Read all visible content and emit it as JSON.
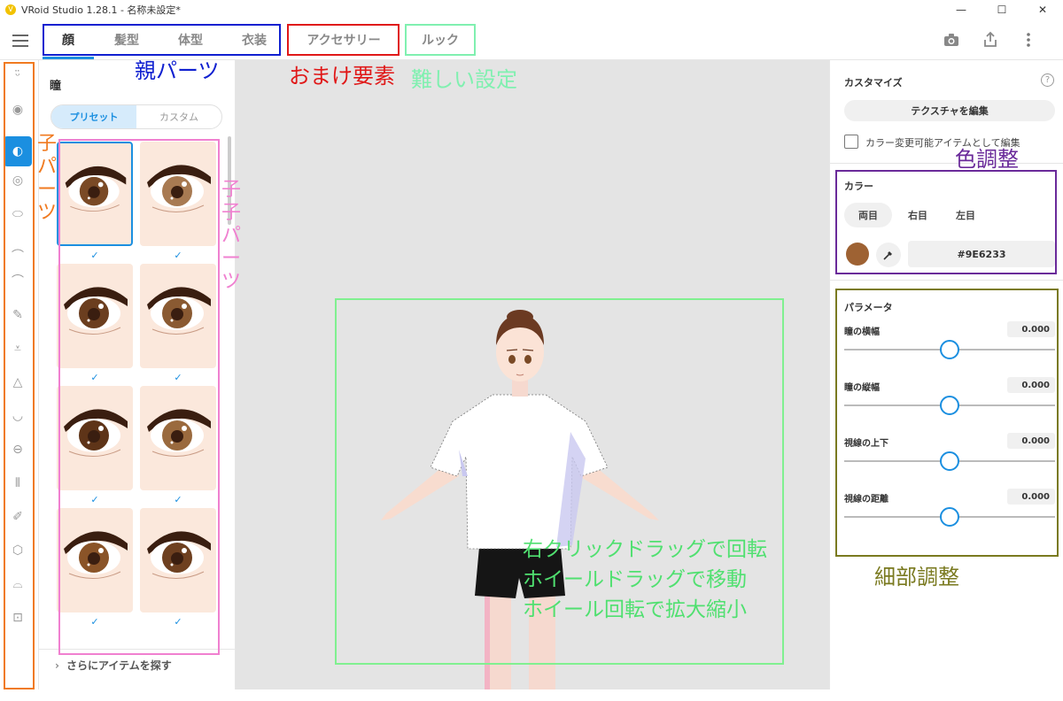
{
  "window": {
    "title": "VRoid Studio 1.28.1 - 名称未設定*",
    "minimize": "—",
    "maximize": "☐",
    "close": "✕"
  },
  "tabs": [
    {
      "label": "顔",
      "active": true
    },
    {
      "label": "髪型",
      "active": false
    },
    {
      "label": "体型",
      "active": false
    },
    {
      "label": "衣装",
      "active": false
    },
    {
      "label": "アクセサリー",
      "active": false
    },
    {
      "label": "ルック",
      "active": false
    }
  ],
  "toolbar_icons": [
    "camera-icon",
    "share-icon",
    "more-vertical-icon"
  ],
  "rail_icons": [
    "face-icon",
    "eyebrow-shape-icon",
    "iris-icon",
    "eye-white-icon",
    "eye-outline-icon",
    "eyebrow-icon",
    "eyelid-icon",
    "eyeliner-icon",
    "eyelash-icon",
    "nose-icon",
    "mouth-icon",
    "teeth-icon",
    "ears-icon",
    "skin-icon",
    "head-shape-icon",
    "ear-icon",
    "face-other-icon"
  ],
  "left_panel": {
    "title": "瞳",
    "segment": {
      "preset": "プリセット",
      "custom": "カスタム"
    },
    "check_mark": "✓",
    "more_items": "さらにアイテムを探す",
    "thumbnails": [
      {
        "name": "iris-preset-1",
        "iris": "#7a4a26",
        "selected": true
      },
      {
        "name": "iris-preset-2",
        "iris": "#a87a52",
        "selected": false
      },
      {
        "name": "iris-preset-3",
        "iris": "#6b3e1f",
        "selected": false
      },
      {
        "name": "iris-preset-4",
        "iris": "#8a5a32",
        "selected": false
      },
      {
        "name": "iris-preset-5",
        "iris": "#5e3418",
        "selected": false
      },
      {
        "name": "iris-preset-6",
        "iris": "#9a6a3e",
        "selected": false
      },
      {
        "name": "iris-preset-7",
        "iris": "#8a5428",
        "selected": false
      },
      {
        "name": "iris-preset-8",
        "iris": "#6e4020",
        "selected": false
      }
    ]
  },
  "right_panel": {
    "customize_title": "カスタマイズ",
    "help": "?",
    "edit_texture": "テクスチャを編集",
    "color_editable_label": "カラー変更可能アイテムとして編集",
    "color_title": "カラー",
    "eye_tabs": [
      "両目",
      "右目",
      "左目"
    ],
    "color_hex": "#9E6233",
    "color_value": "#9e6233",
    "params_title": "パラメータ",
    "params": [
      {
        "label": "瞳の横幅",
        "value": "0.000",
        "level": 0.5
      },
      {
        "label": "瞳の縦幅",
        "value": "0.000",
        "level": 0.5
      },
      {
        "label": "視線の上下",
        "value": "0.000",
        "level": 0.5
      },
      {
        "label": "視線の距離",
        "value": "0.000",
        "level": 0.5
      }
    ]
  },
  "annotations": {
    "parent_parts": "親パーツ",
    "extras": "おまけ要素",
    "hard_settings": "難しい設定",
    "child_parts": "子パーツ",
    "grandchild_parts": "子子パーツ",
    "color_adjust": "色調整",
    "fine_adjust": "細部調整",
    "viewport_help": [
      "右クリックドラッグで回転",
      "ホイールドラッグで移動",
      "ホイール回転で拡大縮小"
    ]
  },
  "colors": {
    "accent": "#1b8fe0",
    "annotation_blue": "#1020d0",
    "annotation_red": "#e01818",
    "annotation_mint": "#80f0b0",
    "annotation_orange": "#f07a20",
    "annotation_pink": "#f080d0",
    "annotation_purple": "#6a2a9a",
    "annotation_olive": "#7a7a20",
    "annotation_green": "#50e070"
  }
}
